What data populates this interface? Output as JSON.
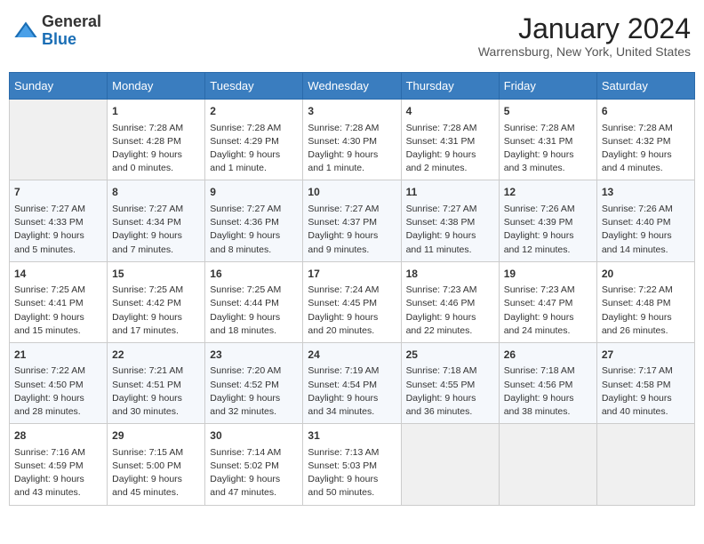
{
  "header": {
    "logo_general": "General",
    "logo_blue": "Blue",
    "title": "January 2024",
    "subtitle": "Warrensburg, New York, United States"
  },
  "days_of_week": [
    "Sunday",
    "Monday",
    "Tuesday",
    "Wednesday",
    "Thursday",
    "Friday",
    "Saturday"
  ],
  "weeks": [
    [
      {
        "num": "",
        "info": ""
      },
      {
        "num": "1",
        "info": "Sunrise: 7:28 AM\nSunset: 4:28 PM\nDaylight: 9 hours\nand 0 minutes."
      },
      {
        "num": "2",
        "info": "Sunrise: 7:28 AM\nSunset: 4:29 PM\nDaylight: 9 hours\nand 1 minute."
      },
      {
        "num": "3",
        "info": "Sunrise: 7:28 AM\nSunset: 4:30 PM\nDaylight: 9 hours\nand 1 minute."
      },
      {
        "num": "4",
        "info": "Sunrise: 7:28 AM\nSunset: 4:31 PM\nDaylight: 9 hours\nand 2 minutes."
      },
      {
        "num": "5",
        "info": "Sunrise: 7:28 AM\nSunset: 4:31 PM\nDaylight: 9 hours\nand 3 minutes."
      },
      {
        "num": "6",
        "info": "Sunrise: 7:28 AM\nSunset: 4:32 PM\nDaylight: 9 hours\nand 4 minutes."
      }
    ],
    [
      {
        "num": "7",
        "info": "Sunrise: 7:27 AM\nSunset: 4:33 PM\nDaylight: 9 hours\nand 5 minutes."
      },
      {
        "num": "8",
        "info": "Sunrise: 7:27 AM\nSunset: 4:34 PM\nDaylight: 9 hours\nand 7 minutes."
      },
      {
        "num": "9",
        "info": "Sunrise: 7:27 AM\nSunset: 4:36 PM\nDaylight: 9 hours\nand 8 minutes."
      },
      {
        "num": "10",
        "info": "Sunrise: 7:27 AM\nSunset: 4:37 PM\nDaylight: 9 hours\nand 9 minutes."
      },
      {
        "num": "11",
        "info": "Sunrise: 7:27 AM\nSunset: 4:38 PM\nDaylight: 9 hours\nand 11 minutes."
      },
      {
        "num": "12",
        "info": "Sunrise: 7:26 AM\nSunset: 4:39 PM\nDaylight: 9 hours\nand 12 minutes."
      },
      {
        "num": "13",
        "info": "Sunrise: 7:26 AM\nSunset: 4:40 PM\nDaylight: 9 hours\nand 14 minutes."
      }
    ],
    [
      {
        "num": "14",
        "info": "Sunrise: 7:25 AM\nSunset: 4:41 PM\nDaylight: 9 hours\nand 15 minutes."
      },
      {
        "num": "15",
        "info": "Sunrise: 7:25 AM\nSunset: 4:42 PM\nDaylight: 9 hours\nand 17 minutes."
      },
      {
        "num": "16",
        "info": "Sunrise: 7:25 AM\nSunset: 4:44 PM\nDaylight: 9 hours\nand 18 minutes."
      },
      {
        "num": "17",
        "info": "Sunrise: 7:24 AM\nSunset: 4:45 PM\nDaylight: 9 hours\nand 20 minutes."
      },
      {
        "num": "18",
        "info": "Sunrise: 7:23 AM\nSunset: 4:46 PM\nDaylight: 9 hours\nand 22 minutes."
      },
      {
        "num": "19",
        "info": "Sunrise: 7:23 AM\nSunset: 4:47 PM\nDaylight: 9 hours\nand 24 minutes."
      },
      {
        "num": "20",
        "info": "Sunrise: 7:22 AM\nSunset: 4:48 PM\nDaylight: 9 hours\nand 26 minutes."
      }
    ],
    [
      {
        "num": "21",
        "info": "Sunrise: 7:22 AM\nSunset: 4:50 PM\nDaylight: 9 hours\nand 28 minutes."
      },
      {
        "num": "22",
        "info": "Sunrise: 7:21 AM\nSunset: 4:51 PM\nDaylight: 9 hours\nand 30 minutes."
      },
      {
        "num": "23",
        "info": "Sunrise: 7:20 AM\nSunset: 4:52 PM\nDaylight: 9 hours\nand 32 minutes."
      },
      {
        "num": "24",
        "info": "Sunrise: 7:19 AM\nSunset: 4:54 PM\nDaylight: 9 hours\nand 34 minutes."
      },
      {
        "num": "25",
        "info": "Sunrise: 7:18 AM\nSunset: 4:55 PM\nDaylight: 9 hours\nand 36 minutes."
      },
      {
        "num": "26",
        "info": "Sunrise: 7:18 AM\nSunset: 4:56 PM\nDaylight: 9 hours\nand 38 minutes."
      },
      {
        "num": "27",
        "info": "Sunrise: 7:17 AM\nSunset: 4:58 PM\nDaylight: 9 hours\nand 40 minutes."
      }
    ],
    [
      {
        "num": "28",
        "info": "Sunrise: 7:16 AM\nSunset: 4:59 PM\nDaylight: 9 hours\nand 43 minutes."
      },
      {
        "num": "29",
        "info": "Sunrise: 7:15 AM\nSunset: 5:00 PM\nDaylight: 9 hours\nand 45 minutes."
      },
      {
        "num": "30",
        "info": "Sunrise: 7:14 AM\nSunset: 5:02 PM\nDaylight: 9 hours\nand 47 minutes."
      },
      {
        "num": "31",
        "info": "Sunrise: 7:13 AM\nSunset: 5:03 PM\nDaylight: 9 hours\nand 50 minutes."
      },
      {
        "num": "",
        "info": ""
      },
      {
        "num": "",
        "info": ""
      },
      {
        "num": "",
        "info": ""
      }
    ]
  ]
}
